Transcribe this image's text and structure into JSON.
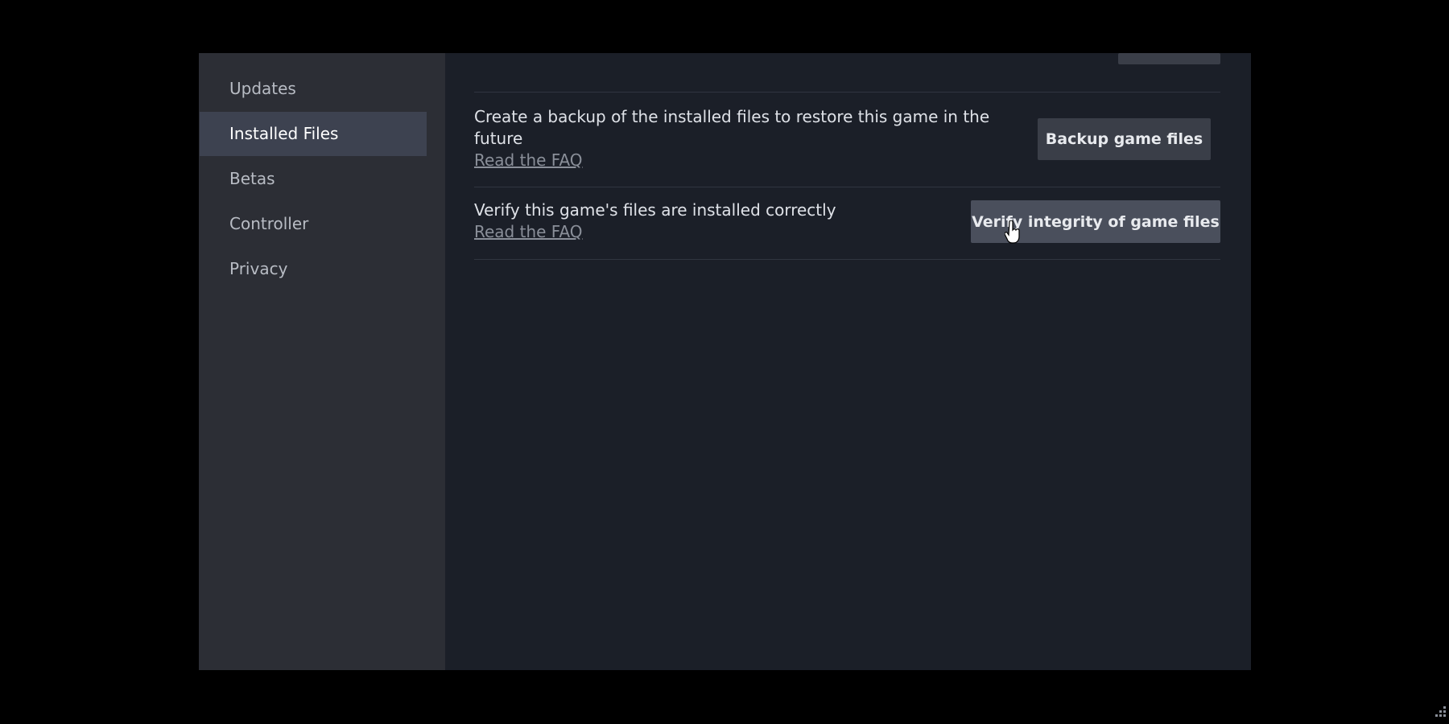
{
  "sidebar": {
    "items": [
      {
        "label": "Updates",
        "selected": false
      },
      {
        "label": "Installed Files",
        "selected": true
      },
      {
        "label": "Betas",
        "selected": false
      },
      {
        "label": "Controller",
        "selected": false
      },
      {
        "label": "Privacy",
        "selected": false
      }
    ]
  },
  "main": {
    "backup": {
      "description": "Create a backup of the installed files to restore this game in the future",
      "faq": "Read the FAQ",
      "button": "Backup game files"
    },
    "verify": {
      "description": "Verify this game's files are installed correctly",
      "faq": "Read the FAQ",
      "button": "Verify integrity of game files"
    }
  },
  "colors": {
    "sidebar": "#2c2e35",
    "content": "#1b1f28",
    "selected": "#3d4250"
  }
}
